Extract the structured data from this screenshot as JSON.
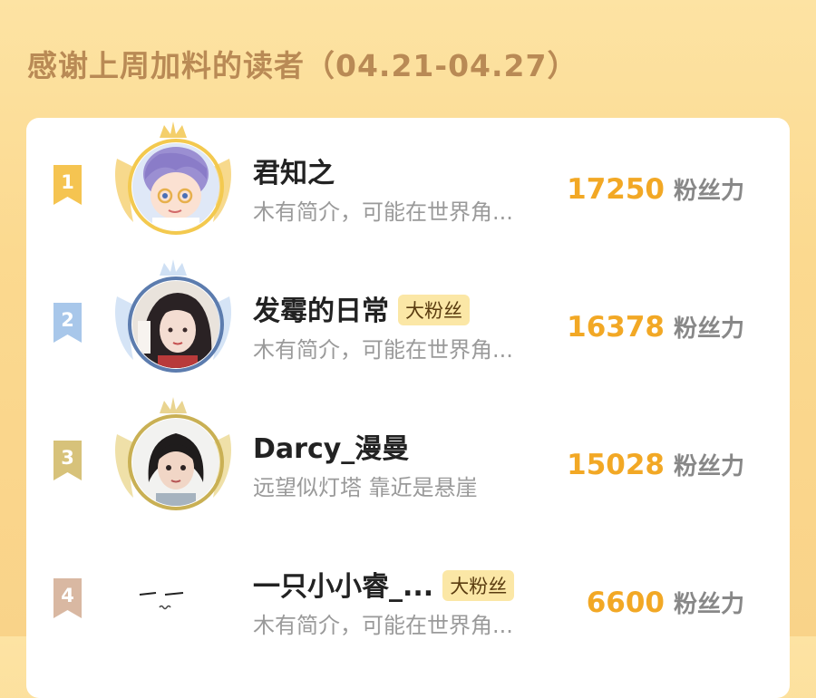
{
  "header": {
    "title": "感谢上周加料的读者（04.21-04.27）"
  },
  "colors": {
    "score": "#f2a825",
    "rank_1": "#f5c451",
    "rank_2": "#a8c7ea",
    "rank_3": "#d7c27a",
    "rank_4": "#d9b8a2"
  },
  "readers": [
    {
      "rank": "1",
      "name": "君知之",
      "tag": "",
      "bio": "木有简介，可能在世界角...",
      "score": "17250",
      "unit": "粉丝力",
      "frame": "gold-crown-frame"
    },
    {
      "rank": "2",
      "name": "发霉的日常",
      "tag": "大粉丝",
      "bio": "木有简介，可能在世界角...",
      "score": "16378",
      "unit": "粉丝力",
      "frame": "silver-crown-frame"
    },
    {
      "rank": "3",
      "name": "Darcy_漫曼",
      "tag": "",
      "bio": "远望似灯塔 靠近是悬崖",
      "score": "15028",
      "unit": "粉丝力",
      "frame": "bronze-crown-frame"
    },
    {
      "rank": "4",
      "name": "一只小小睿_...",
      "tag": "大粉丝",
      "bio": "木有简介，可能在世界角...",
      "score": "6600",
      "unit": "粉丝力",
      "frame": "none"
    }
  ]
}
